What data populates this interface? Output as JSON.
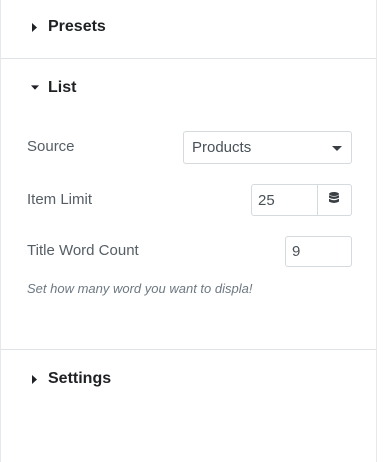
{
  "sections": {
    "presets": {
      "title": "Presets",
      "expanded": false
    },
    "list": {
      "title": "List",
      "expanded": true
    },
    "settings": {
      "title": "Settings",
      "expanded": false
    }
  },
  "fields": {
    "source": {
      "label": "Source",
      "value": "Products"
    },
    "item_limit": {
      "label": "Item Limit",
      "value": "25"
    },
    "title_word_count": {
      "label": "Title Word Count",
      "value": "9"
    }
  },
  "description": "Set how many word you want to displa!",
  "icons": {
    "collapsed": "caret-right-icon",
    "expanded": "caret-down-icon",
    "dynamic": "database-icon",
    "select": "chevron-down-icon"
  }
}
